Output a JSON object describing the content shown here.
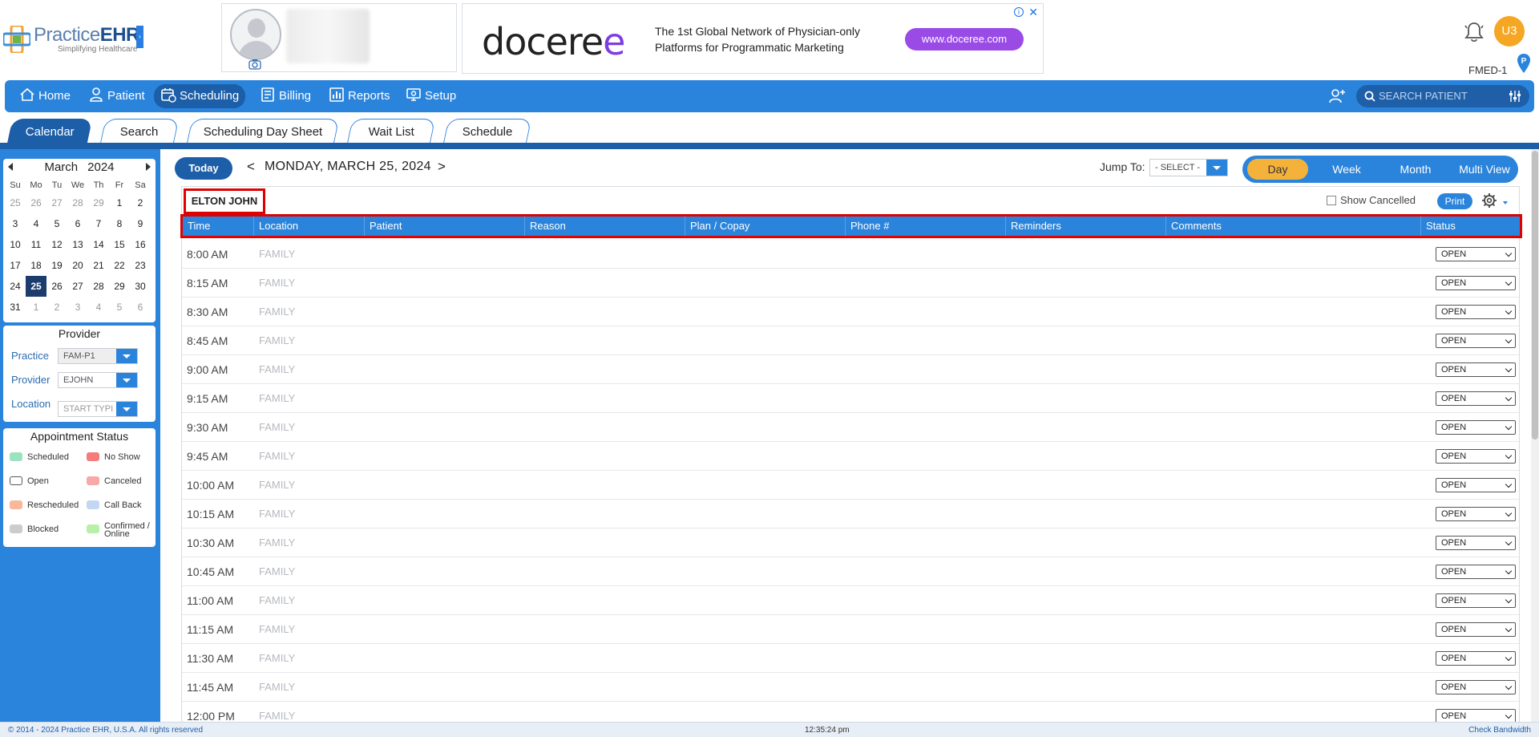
{
  "header": {
    "logo_text_a": "Practice",
    "logo_text_b": "EHR",
    "logo_tagline": "Simplifying Healthcare",
    "user_initials": "U3",
    "facility_code": "FMED-1"
  },
  "ad": {
    "logo_a": "docere",
    "logo_b": "e",
    "text_line1": "The 1st Global Network of Physician-only",
    "text_line2": "Platforms for Programmatic Marketing",
    "button": "www.doceree.com"
  },
  "nav": {
    "items": [
      {
        "label": "Home",
        "icon": "home-icon"
      },
      {
        "label": "Patient",
        "icon": "patient-icon"
      },
      {
        "label": "Scheduling",
        "icon": "calendar-clock-icon"
      },
      {
        "label": "Billing",
        "icon": "billing-icon"
      },
      {
        "label": "Reports",
        "icon": "reports-icon"
      },
      {
        "label": "Setup",
        "icon": "setup-icon"
      }
    ],
    "active": "Scheduling",
    "search_placeholder": "SEARCH PATIENT"
  },
  "subtabs": {
    "items": [
      "Calendar",
      "Search",
      "Scheduling Day Sheet",
      "Wait List",
      "Schedule"
    ],
    "active": "Calendar"
  },
  "mini_calendar": {
    "month": "March",
    "year": "2024",
    "dow": [
      "Su",
      "Mo",
      "Tu",
      "We",
      "Th",
      "Fr",
      "Sa"
    ],
    "weeks": [
      [
        "25",
        "26",
        "27",
        "28",
        "29",
        "1",
        "2"
      ],
      [
        "3",
        "4",
        "5",
        "6",
        "7",
        "8",
        "9"
      ],
      [
        "10",
        "11",
        "12",
        "13",
        "14",
        "15",
        "16"
      ],
      [
        "17",
        "18",
        "19",
        "20",
        "21",
        "22",
        "23"
      ],
      [
        "24",
        "25",
        "26",
        "27",
        "28",
        "29",
        "30"
      ],
      [
        "31",
        "1",
        "2",
        "3",
        "4",
        "5",
        "6"
      ]
    ],
    "selected": "25"
  },
  "provider_panel": {
    "title": "Provider",
    "practice_label": "Practice",
    "practice_value": "FAM-P1",
    "provider_label": "Provider",
    "provider_value": "EJOHN",
    "location_label": "Location",
    "location_placeholder": "START TYPI"
  },
  "status_legend": {
    "title": "Appointment Status",
    "items": [
      {
        "label": "Scheduled",
        "color": "#9be3c0"
      },
      {
        "label": "No Show",
        "color": "#f47c7c"
      },
      {
        "label": "Open",
        "color": "#ffffff"
      },
      {
        "label": "Canceled",
        "color": "#f7a9a9"
      },
      {
        "label": "Rescheduled",
        "color": "#f8b89a"
      },
      {
        "label": "Call Back",
        "color": "#c4d7f2"
      },
      {
        "label": "Blocked",
        "color": "#cccccc"
      },
      {
        "label": "Confirmed / Online",
        "color": "#b8f0a8"
      }
    ]
  },
  "toolbar": {
    "today": "Today",
    "prev": "<",
    "date": "MONDAY, MARCH 25, 2024",
    "next": ">",
    "jump_label": "Jump To:",
    "jump_value": "- SELECT -",
    "views": [
      "Day",
      "Week",
      "Month",
      "Multi View"
    ],
    "active_view": "Day"
  },
  "schedule": {
    "provider_name": "ELTON JOHN",
    "show_cancelled": "Show Cancelled",
    "print": "Print",
    "columns": [
      "Time",
      "Location",
      "Patient",
      "Reason",
      "Plan / Copay",
      "Phone #",
      "Reminders",
      "Comments",
      "Status"
    ],
    "rows": [
      {
        "time": "8:00 AM",
        "location": "FAMILY",
        "status": "OPEN"
      },
      {
        "time": "8:15 AM",
        "location": "FAMILY",
        "status": "OPEN"
      },
      {
        "time": "8:30 AM",
        "location": "FAMILY",
        "status": "OPEN"
      },
      {
        "time": "8:45 AM",
        "location": "FAMILY",
        "status": "OPEN"
      },
      {
        "time": "9:00 AM",
        "location": "FAMILY",
        "status": "OPEN"
      },
      {
        "time": "9:15 AM",
        "location": "FAMILY",
        "status": "OPEN"
      },
      {
        "time": "9:30 AM",
        "location": "FAMILY",
        "status": "OPEN"
      },
      {
        "time": "9:45 AM",
        "location": "FAMILY",
        "status": "OPEN"
      },
      {
        "time": "10:00 AM",
        "location": "FAMILY",
        "status": "OPEN"
      },
      {
        "time": "10:15 AM",
        "location": "FAMILY",
        "status": "OPEN"
      },
      {
        "time": "10:30 AM",
        "location": "FAMILY",
        "status": "OPEN"
      },
      {
        "time": "10:45 AM",
        "location": "FAMILY",
        "status": "OPEN"
      },
      {
        "time": "11:00 AM",
        "location": "FAMILY",
        "status": "OPEN"
      },
      {
        "time": "11:15 AM",
        "location": "FAMILY",
        "status": "OPEN"
      },
      {
        "time": "11:30 AM",
        "location": "FAMILY",
        "status": "OPEN"
      },
      {
        "time": "11:45 AM",
        "location": "FAMILY",
        "status": "OPEN"
      },
      {
        "time": "12:00 PM",
        "location": "FAMILY",
        "status": "OPEN"
      }
    ]
  },
  "footer": {
    "copyright": "© 2014 - 2024 Practice EHR, U.S.A. All rights reserved",
    "clock": "12:35:24 pm",
    "bandwidth": "Check Bandwidth"
  }
}
